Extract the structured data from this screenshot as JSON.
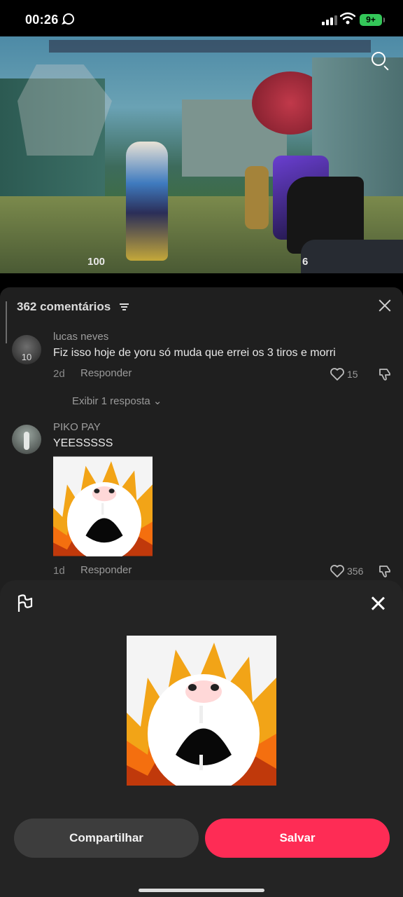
{
  "status_bar": {
    "time": "00:26",
    "battery": "9+",
    "icons": [
      "whatsapp-icon",
      "signal-icon",
      "wifi-icon",
      "battery-icon"
    ]
  },
  "video": {
    "hud_health": "100",
    "hud_ammo": "6",
    "hud_icons": [
      "minimap",
      "search-icon"
    ]
  },
  "comments": {
    "header": "362 comentários",
    "items": [
      {
        "user": "lucas neves",
        "avatar_label": "10",
        "text": "Fiz isso hoje de yoru só muda que errei os 3 tiros e morri",
        "age": "2d",
        "reply_label": "Responder",
        "likes": "15",
        "show_replies": "Exibir 1 resposta"
      },
      {
        "user": "PIKO PAY",
        "text": "YEESSSSS",
        "age": "1d",
        "reply_label": "Responder",
        "likes": "356"
      }
    ]
  },
  "sheet": {
    "share_label": "Compartilhar",
    "save_label": "Salvar"
  },
  "colors": {
    "save_button": "#fe2c55",
    "share_button": "#3d3d3d",
    "sheet_bg": "#242424",
    "comments_bg": "#1f1f1f",
    "battery": "#34c759"
  }
}
